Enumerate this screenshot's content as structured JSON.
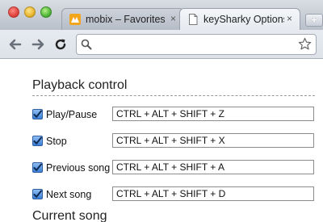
{
  "tabs": [
    {
      "title": "mobix – Favorites",
      "close": "×",
      "active": false,
      "favicon": "mobix-favicon"
    },
    {
      "title": "keySharky Options",
      "close": "×",
      "active": true,
      "favicon": "page-icon"
    }
  ],
  "new_tab_label": "+",
  "omnibox": {
    "value": "",
    "placeholder": ""
  },
  "sections": {
    "playback": "Playback control",
    "current": "Current song"
  },
  "shortcuts": [
    {
      "label": "Play/Pause",
      "value": "CTRL + ALT + SHIFT + Z",
      "checked": true
    },
    {
      "label": "Stop",
      "value": "CTRL + ALT + SHIFT + X",
      "checked": true
    },
    {
      "label": "Previous song",
      "value": "CTRL + ALT + SHIFT + A",
      "checked": true
    },
    {
      "label": "Next song",
      "value": "CTRL + ALT + SHIFT + D",
      "checked": true
    }
  ],
  "colors": {
    "checkbox_accent": "#3a7fd6",
    "tab_active": "#eef1f5",
    "titlebar": "#c7cdd5"
  }
}
